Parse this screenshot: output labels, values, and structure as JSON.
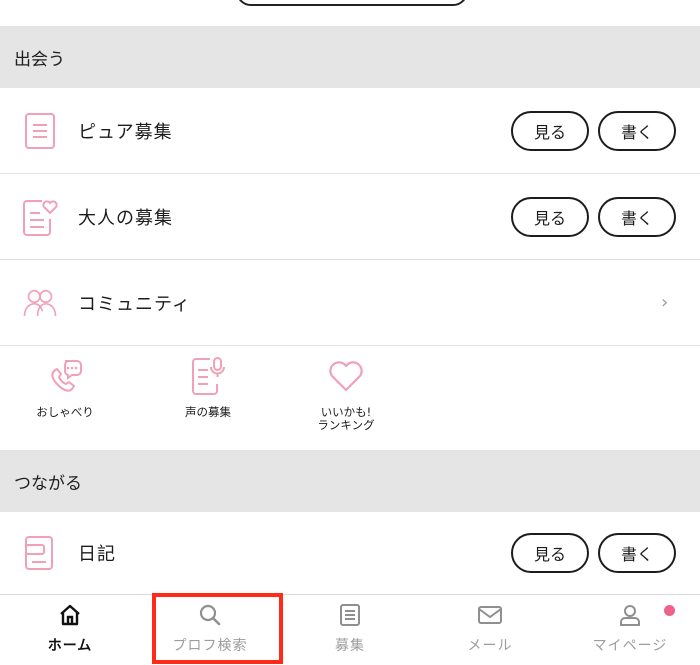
{
  "sections": {
    "meet": "出会う",
    "connect": "つながる"
  },
  "rows": {
    "pure": {
      "label": "ピュア募集",
      "view": "見る",
      "write": "書く"
    },
    "adult": {
      "label": "大人の募集",
      "view": "見る",
      "write": "書く"
    },
    "community": {
      "label": "コミュニティ",
      "chevron": "›"
    },
    "diary": {
      "label": "日記",
      "view": "見る",
      "write": "書く"
    }
  },
  "shortcuts": [
    {
      "label": "おしゃべり",
      "icon": "phone-chat-icon"
    },
    {
      "label": "声の募集",
      "icon": "voice-post-icon"
    },
    {
      "label": "いいかも!\nランキング",
      "icon": "heart-icon"
    }
  ],
  "bottom_nav": [
    {
      "label": "ホーム",
      "icon": "home-icon",
      "active": true
    },
    {
      "label": "プロフ検索",
      "icon": "search-icon",
      "active": false
    },
    {
      "label": "募集",
      "icon": "list-icon",
      "active": false
    },
    {
      "label": "メール",
      "icon": "mail-icon",
      "active": false
    },
    {
      "label": "マイページ",
      "icon": "person-icon",
      "active": false,
      "notification_dot": true
    }
  ],
  "colors": {
    "accent_pink": "#f2a0b8",
    "notification": "#f06189",
    "highlight": "#ff2a1a",
    "section_bg": "#e5e5e5"
  }
}
